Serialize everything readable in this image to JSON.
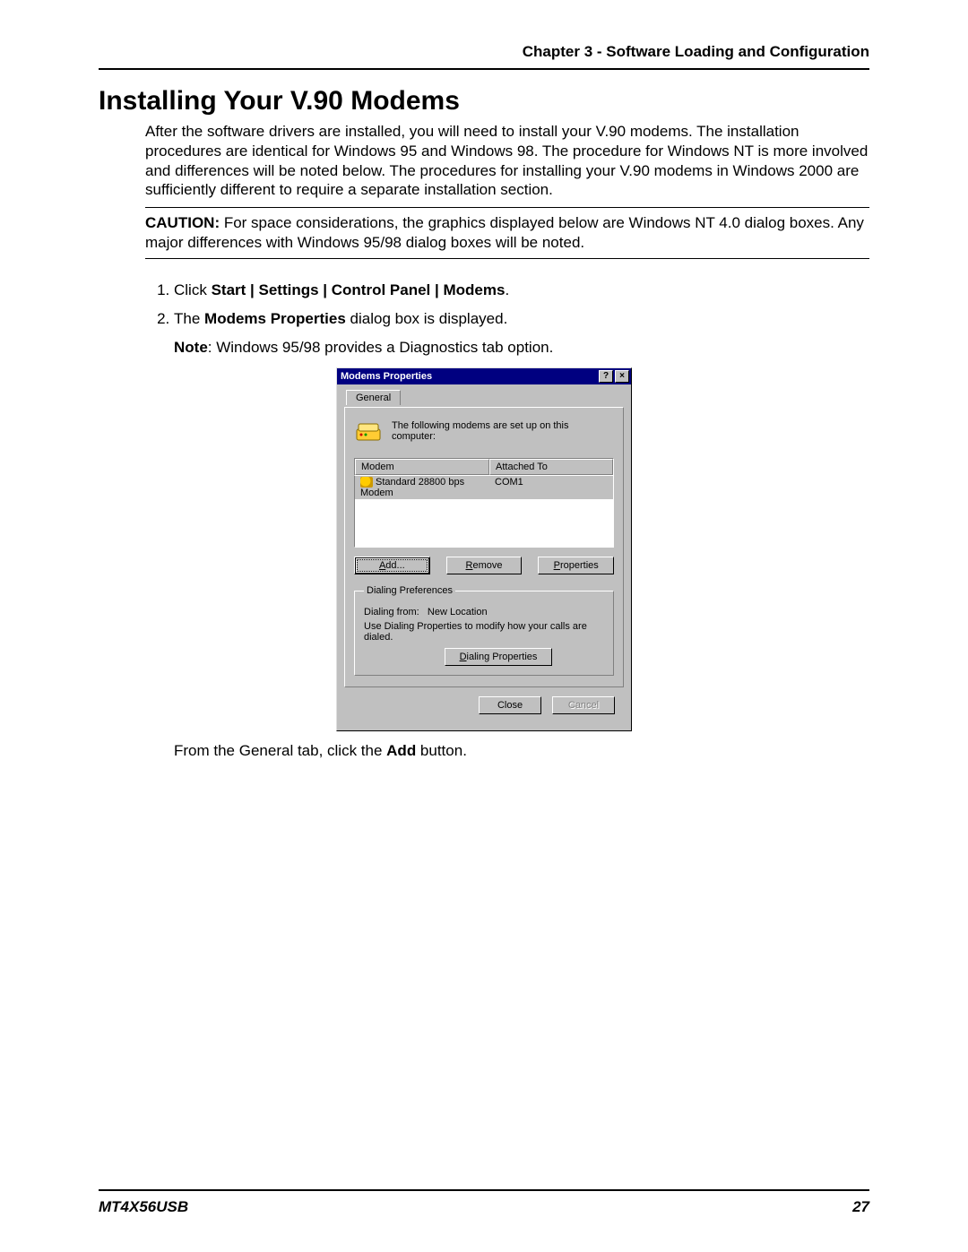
{
  "header": {
    "chapter": "Chapter 3 - Software Loading and Configuration"
  },
  "section": {
    "title": "Installing Your V.90 Modems"
  },
  "intro": "After the software drivers are installed, you will  need to install your V.90 modems. The installation procedures are identical for Windows 95 and Windows 98. The procedure for  Windows NT is more involved and differences will be noted below.  The procedures for installing your V.90 modems in Windows 2000 are sufficiently different to require a separate installation section.",
  "caution": {
    "label": "CAUTION:",
    "text": " For space considerations, the graphics displayed below are Windows NT 4.0 dialog boxes. Any major differences with Windows 95/98 dialog boxes will be noted."
  },
  "steps": {
    "s1": {
      "pre": "Click ",
      "bold": "Start | Settings | Control Panel | Modems",
      "post": "."
    },
    "s2": {
      "pre": "The ",
      "bold": "Modems Properties",
      "post": " dialog box is displayed."
    },
    "note": {
      "label": "Note",
      "text": ": Windows 95/98 provides a Diagnostics tab option."
    },
    "after": {
      "pre": "From the General tab, click the ",
      "bold": "Add",
      "post": " button."
    }
  },
  "dialog": {
    "title": "Modems Properties",
    "help_glyph": "?",
    "close_glyph": "×",
    "tab": "General",
    "info": "The following modems are set up on this computer:",
    "col1": "Modem",
    "col2": "Attached To",
    "row_name": "Standard 28800 bps Modem",
    "row_port": "COM1",
    "btn_add": "Add...",
    "btn_remove": "Remove",
    "btn_props": "Properties",
    "prefs_legend": "Dialing Preferences",
    "dialing_from_label": "Dialing from:",
    "dialing_from_value": "New Location",
    "prefs_hint": "Use Dialing Properties to modify how your calls are dialed.",
    "btn_dp": "Dialing Properties",
    "btn_close": "Close",
    "btn_cancel": "Cancel"
  },
  "footer": {
    "doc": "MT4X56USB",
    "page": "27"
  }
}
